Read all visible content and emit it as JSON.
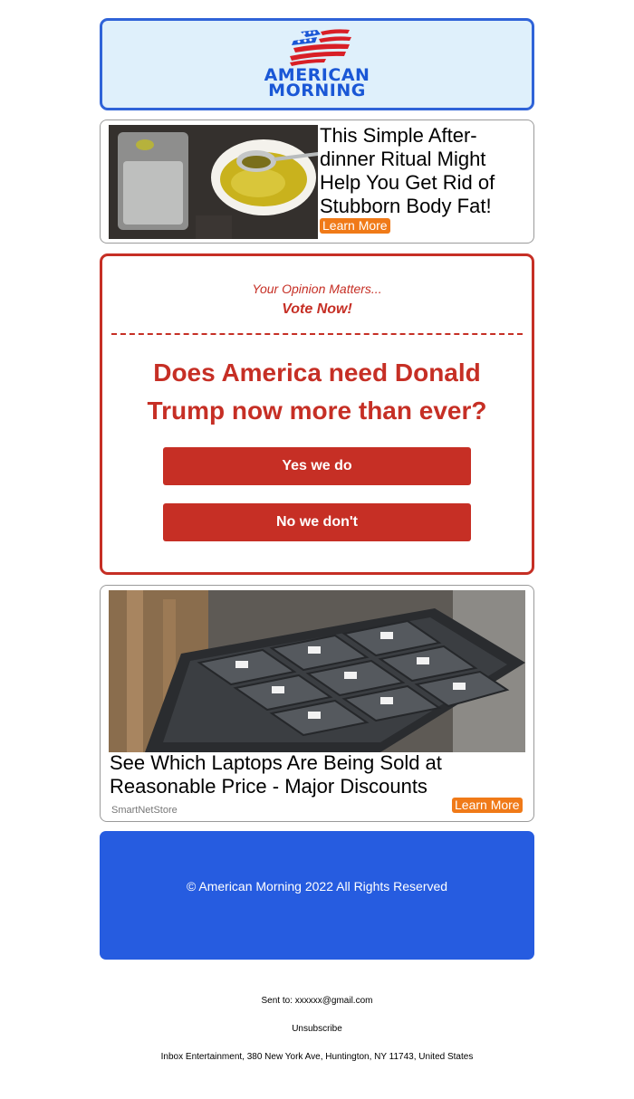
{
  "header": {
    "logo_line1": "AMERICAN",
    "logo_line2": "MORNING",
    "logo_colors": {
      "red": "#d81f26",
      "blue": "#1a57d6"
    }
  },
  "ad_top": {
    "title": "This Simple After-dinner Ritual Might Help You Get Rid of Stubborn Body Fat!",
    "cta": "Learn More"
  },
  "poll": {
    "tagline": "Your Opinion Matters...",
    "vote_label": "Vote Now!",
    "question": "Does America need Donald Trump now more than ever?",
    "yes_label": "Yes we do",
    "no_label": "No we don't",
    "accent": "#c62f25"
  },
  "ad_bottom": {
    "title": "See Which Laptops Are Being Sold at Reasonable Price - Major Discounts",
    "source": "SmartNetStore",
    "cta": "Learn More"
  },
  "footer": {
    "copyright": "© American Morning 2022 All Rights Reserved",
    "background": "#265ce0"
  },
  "meta": {
    "sent_to": "Sent to: xxxxxx@gmail.com",
    "unsubscribe": "Unsubscribe",
    "address": "Inbox Entertainment, 380 New York Ave, Huntington, NY 11743, United States"
  }
}
